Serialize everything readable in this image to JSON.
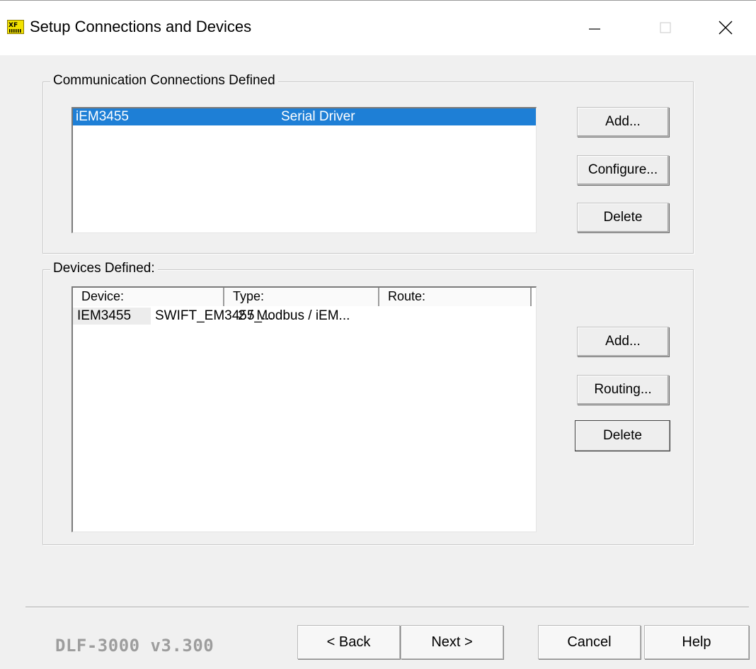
{
  "window": {
    "title": "Setup Connections and Devices",
    "controls": [
      "minimize-icon",
      "maximize-icon",
      "close-icon"
    ]
  },
  "connections": {
    "group_label": "Communication Connections Defined",
    "rows": [
      {
        "name": "iEM3455",
        "driver": "Serial Driver",
        "selected": true
      }
    ],
    "buttons": {
      "add": "Add...",
      "configure": "Configure...",
      "delete": "Delete"
    }
  },
  "devices": {
    "group_label": "Devices Defined:",
    "columns": [
      "Device:",
      "Type:",
      "Route:"
    ],
    "rows": [
      {
        "device": "IEM3455",
        "type": "SWIFT_EM3455_...",
        "route": "2 / Modbus / iEM..."
      }
    ],
    "buttons": {
      "add": "Add...",
      "routing": "Routing...",
      "delete": "Delete"
    }
  },
  "footer": {
    "version": "DLF-3000 v3.300",
    "back": "< Back",
    "next": "Next >",
    "cancel": "Cancel",
    "help": "Help"
  },
  "colors": {
    "selection": "#1e7fd6",
    "background": "#f0f0f0",
    "version_text": "#9d9d9d",
    "app_icon": "#f2e200"
  }
}
